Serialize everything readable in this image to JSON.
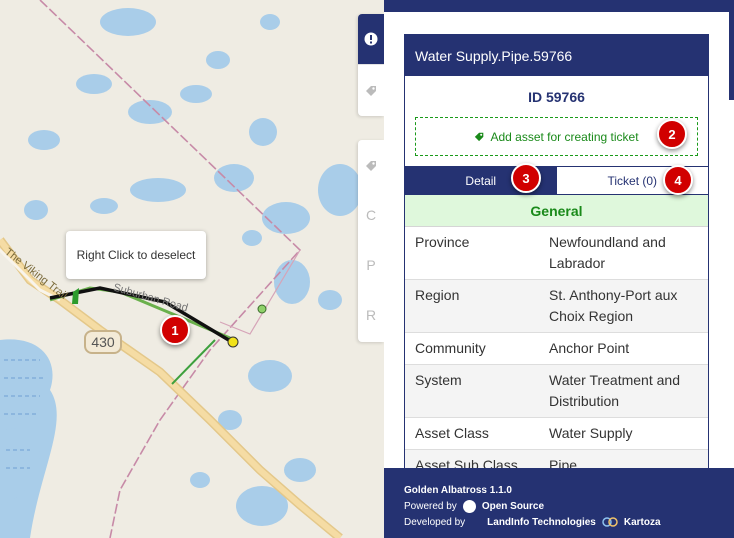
{
  "map": {
    "tooltip": "Right Click to deselect",
    "road_label": "430",
    "trail_label": "The Viking Trail",
    "road_name": "Suburban Road",
    "badges": [
      "1",
      "2",
      "3",
      "4"
    ]
  },
  "toolstrip": {
    "upper": [
      "alert-icon",
      "tag-icon"
    ],
    "lower": [
      "tag-icon",
      "C",
      "P",
      "R"
    ]
  },
  "panel": {
    "title": "Water Supply.Pipe.59766",
    "asset_id": "ID 59766",
    "add_asset": "Add asset for creating ticket",
    "tabs": {
      "detail": "Detail",
      "ticket": "Ticket (0)"
    },
    "section": "General",
    "rows": [
      {
        "key": "Province",
        "value": "Newfoundland and Labrador"
      },
      {
        "key": "Region",
        "value": "St. Anthony-Port aux Choix Region"
      },
      {
        "key": "Community",
        "value": "Anchor Point"
      },
      {
        "key": "System",
        "value": "Water Treatment and Distribution"
      },
      {
        "key": "Asset Class",
        "value": "Water Supply"
      },
      {
        "key": "Asset Sub Class",
        "value": "Pipe"
      }
    ]
  },
  "footer": {
    "app": "Golden Albatross 1.1.0",
    "powered_by": "Powered by",
    "open_source": "Open Source",
    "developed_by": "Developed by",
    "dev1": "LandInfo Technologies",
    "dev2": "Kartoza"
  },
  "colors": {
    "navy": "#253272",
    "green": "#1a8a1a",
    "badge": "#d10000"
  }
}
